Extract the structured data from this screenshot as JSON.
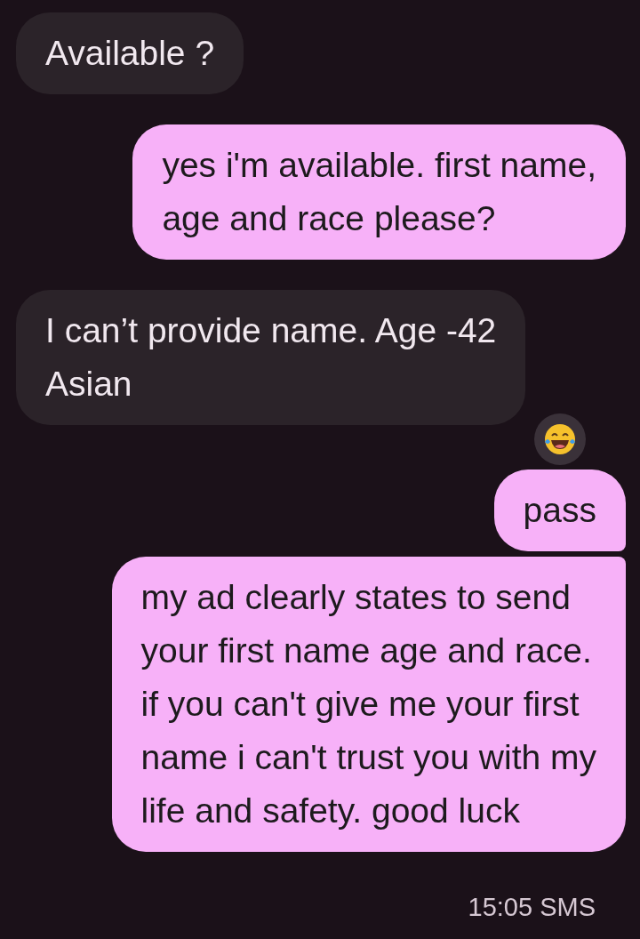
{
  "messages": [
    {
      "kind": "incoming",
      "text": "Available ?"
    },
    {
      "kind": "outgoing",
      "text": "yes i'm available. first name,\nage and race please?"
    },
    {
      "kind": "incoming",
      "text": "I can’t provide name. Age -42\nAsian",
      "reaction": {
        "kind": "laugh"
      }
    },
    {
      "kind": "outgoing",
      "text": "pass"
    },
    {
      "kind": "outgoing",
      "text": "my ad clearly states to send\nyour first name age and race.\nif you can't give me your first\nname i can't trust you with my\nlife and safety. good luck"
    }
  ],
  "timestamp": "15:05 SMS"
}
